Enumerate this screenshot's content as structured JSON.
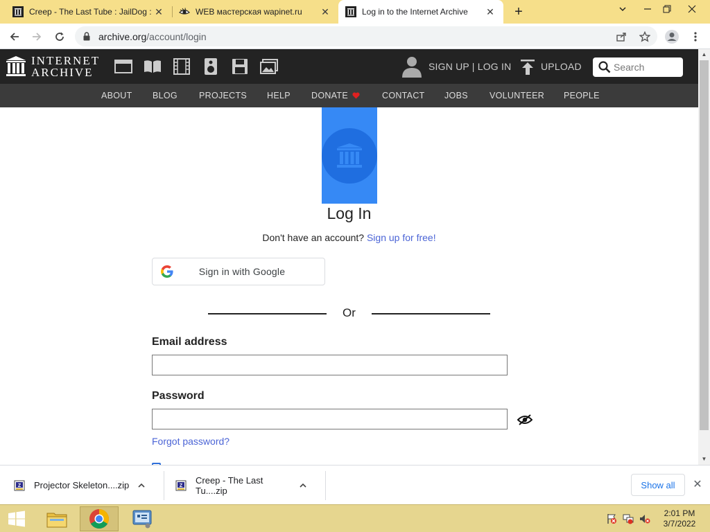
{
  "browser": {
    "tabs": [
      {
        "title": "Creep - The Last Tube : JailDog :",
        "active": false
      },
      {
        "title": "WEB мастерская wapinet.ru",
        "active": false
      },
      {
        "title": "Log in to the Internet Archive",
        "active": true
      }
    ],
    "new_tab_icon": "plus-icon",
    "url_host": "archive.org",
    "url_path": "/account/login"
  },
  "ia_header": {
    "logo_line1": "INTERNET",
    "logo_line2": "ARCHIVE",
    "media_icons": [
      "web-icon",
      "texts-icon",
      "video-icon",
      "audio-icon",
      "software-icon",
      "images-icon"
    ],
    "signup_login": "SIGN UP | LOG IN",
    "upload": "UPLOAD",
    "search_placeholder": "Search"
  },
  "ia_nav": {
    "items": [
      "ABOUT",
      "BLOG",
      "PROJECTS",
      "HELP",
      "DONATE",
      "CONTACT",
      "JOBS",
      "VOLUNTEER",
      "PEOPLE"
    ],
    "heart_color": "#e02020"
  },
  "login": {
    "title": "Log In",
    "no_account_text": "Don't have an account?",
    "signup_link": "Sign up for free",
    "signup_suffix": "!",
    "google_button": "Sign in with Google",
    "or_text": "Or",
    "email_label": "Email address",
    "email_value": "",
    "password_label": "Password",
    "password_value": "",
    "forgot_link": "Forgot password?",
    "accent_color": "#3689f5"
  },
  "downloads": {
    "items": [
      {
        "name": "Projector Skeleton....zip"
      },
      {
        "name": "Creep - The Last Tu....zip"
      }
    ],
    "show_all": "Show all"
  },
  "taskbar": {
    "time": "2:01 PM",
    "date": "3/7/2022"
  }
}
